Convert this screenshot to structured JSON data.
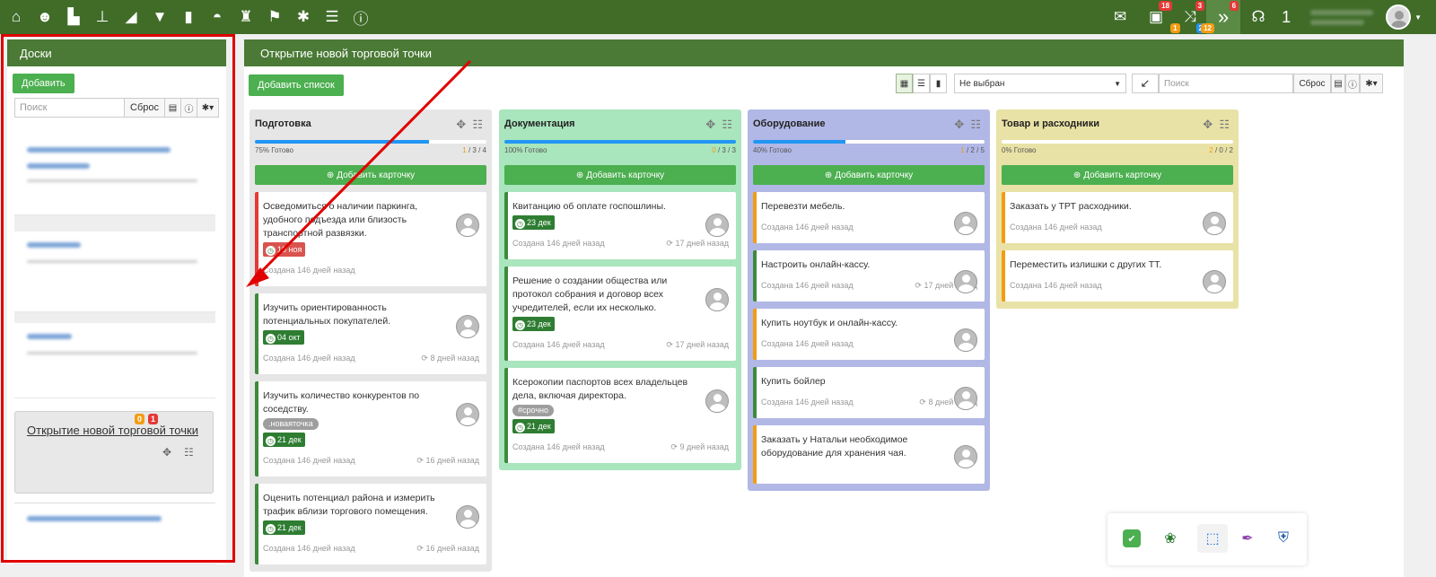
{
  "topbar": {
    "icons_left": [
      "home-icon",
      "user-icon",
      "factory-icon",
      "sitemap-icon",
      "chart-area-icon",
      "filter-icon",
      "bar-chart-icon",
      "hat-icon",
      "money-bag-icon",
      "flag-icon",
      "gear-icon",
      "list-icon",
      "info-icon"
    ],
    "mail_icon": "mail-icon",
    "briefcase_badge": "18",
    "shuffle_badge_top": "3",
    "shuffle_badge_a": "1",
    "shuffle_badge_b": "2",
    "arrows_badge_top": "6",
    "arrows_badge_b": "12",
    "headset_icon": "headset-icon",
    "counter": "1"
  },
  "left_panel": {
    "title": "Доски",
    "add_label": "Добавить",
    "search_placeholder": "Поиск",
    "reset_label": "Сброс",
    "board_active": {
      "title": "Открытие новой торговой точки",
      "badge_orange": "0",
      "badge_red": "1"
    }
  },
  "main": {
    "title": "Открытие новой торговой точки",
    "add_list_label": "Добавить список",
    "select_value": "Не выбран",
    "search_placeholder": "Поиск",
    "reset_label": "Сброс",
    "add_card_label": "Добавить карточку",
    "columns": [
      {
        "title": "Подготовка",
        "progress_label": "75% Готово",
        "progress": 0.75,
        "count_a": "1",
        "count_b": "3",
        "count_c": "4",
        "cards": [
          {
            "text": "Осведомиться о наличии паркинга, удобного подъезда или близость транспортной развязки.",
            "date": "10 ноя",
            "created": "Создана 146 дней назад",
            "updated": ""
          },
          {
            "text": "Изучить ориентированность потенциальных покупателей.",
            "date": "04 окт",
            "created": "Создана 146 дней назад",
            "updated": "8 дней назад"
          },
          {
            "text": "Изучить количество конкурентов по соседству.",
            "tag": ".новаяточка",
            "date": "21 дек",
            "created": "Создана 146 дней назад",
            "updated": "16 дней назад"
          },
          {
            "text": "Оценить потенциал района и измерить трафик вблизи торгового помещения.",
            "date": "21 дек",
            "created": "Создана 146 дней назад",
            "updated": "16 дней назад"
          }
        ]
      },
      {
        "title": "Документация",
        "progress_label": "100% Готово",
        "progress": 1.0,
        "count_a": "0",
        "count_b": "3",
        "count_c": "3",
        "cards": [
          {
            "text": "Квитанцию об оплате госпошлины.",
            "date": "23 дек",
            "created": "Создана 146 дней назад",
            "updated": "17 дней назад"
          },
          {
            "text": "Решение о создании общества или протокол собрания и договор всех учредителей, если их несколько.",
            "date": "23 дек",
            "created": "Создана 146 дней назад",
            "updated": "17 дней назад"
          },
          {
            "text": "Ксерокопии паспортов всех владельцев дела, включая директора.",
            "tag": "#срочно",
            "date": "21 дек",
            "created": "Создана 146 дней назад",
            "updated": "9 дней назад"
          }
        ]
      },
      {
        "title": "Оборудование",
        "progress_label": "40% Готово",
        "progress": 0.4,
        "count_a": "1",
        "count_b": "2",
        "count_c": "5",
        "cards": [
          {
            "text": "Перевезти мебель.",
            "created": "Создана 146 дней назад",
            "updated": ""
          },
          {
            "text": "Настроить онлайн-кассу.",
            "created": "Создана 146 дней назад",
            "updated": "17 дней назад"
          },
          {
            "text": "Купить ноутбук и онлайн-кассу.",
            "created": "Создана 146 дней назад",
            "updated": ""
          },
          {
            "text": "Купить бойлер",
            "created": "Создана 146 дней назад",
            "updated": "8 дней назад"
          },
          {
            "text": "Заказать у Натальи необходимое оборудование для хранения чая.",
            "created": "",
            "updated": ""
          }
        ]
      },
      {
        "title": "Товар и расходники",
        "progress_label": "0% Готово",
        "progress": 0.0,
        "count_a": "2",
        "count_b": "0",
        "count_c": "2",
        "cards": [
          {
            "text": "Заказать у ТРТ расходники.",
            "created": "Создана 146 дней назад",
            "updated": ""
          },
          {
            "text": "Переместить излишки с других ТТ.",
            "created": "Создана 146 дней назад",
            "updated": ""
          }
        ]
      }
    ]
  },
  "colors": {
    "topbar": "#406c28",
    "panel_head": "#4a7a35",
    "col1": "#e6e6e6",
    "col2": "#a9e5bd",
    "col3": "#b1b8e6",
    "col4": "#e9e2a6",
    "annotation": "#e00000"
  }
}
